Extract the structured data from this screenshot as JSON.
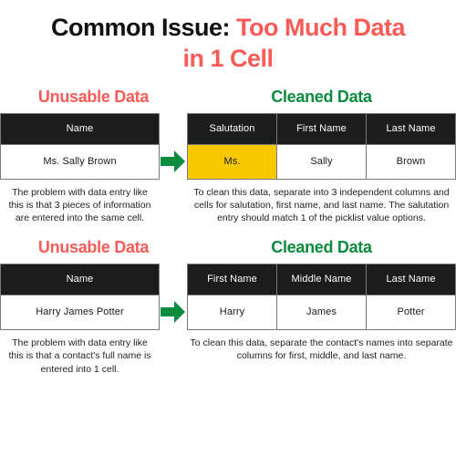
{
  "title": {
    "lead": "Common Issue: ",
    "accent_line1": "Too Much Data",
    "accent_line2": "in 1 Cell"
  },
  "colors": {
    "accent_red": "#fb5b56",
    "accent_green": "#0b8b3e",
    "header_black": "#1c1c1c",
    "highlight_yellow": "#f5c800",
    "background": "#ffffff"
  },
  "sections": [
    {
      "left_heading": "Unusable Data",
      "right_heading": "Cleaned Data",
      "arrow_icon": "right-arrow-icon",
      "left_table": {
        "headers": [
          "Name"
        ],
        "rows": [
          [
            "Ms. Sally Brown"
          ]
        ]
      },
      "right_table": {
        "headers": [
          "Salutation",
          "First Name",
          "Last Name"
        ],
        "rows": [
          [
            "Ms.",
            "Sally",
            "Brown"
          ]
        ],
        "highlight_cell": [
          0,
          0
        ]
      },
      "left_caption": "The problem with data entry like this is that 3 pieces of information are entered into the same cell.",
      "right_caption": "To clean this data, separate into 3 independent columns and cells for salutation, first name, and last name. The salutation entry should match 1 of the picklist value options."
    },
    {
      "left_heading": "Unusable Data",
      "right_heading": "Cleaned Data",
      "arrow_icon": "right-arrow-icon",
      "left_table": {
        "headers": [
          "Name"
        ],
        "rows": [
          [
            "Harry James Potter"
          ]
        ]
      },
      "right_table": {
        "headers": [
          "First Name",
          "Middle Name",
          "Last Name"
        ],
        "rows": [
          [
            "Harry",
            "James",
            "Potter"
          ]
        ],
        "highlight_cell": null
      },
      "left_caption": "The problem with data entry like this is that a contact's full name is entered into 1 cell.",
      "right_caption": "To clean this data, separate the contact's names into separate columns for first, middle, and last name."
    }
  ]
}
